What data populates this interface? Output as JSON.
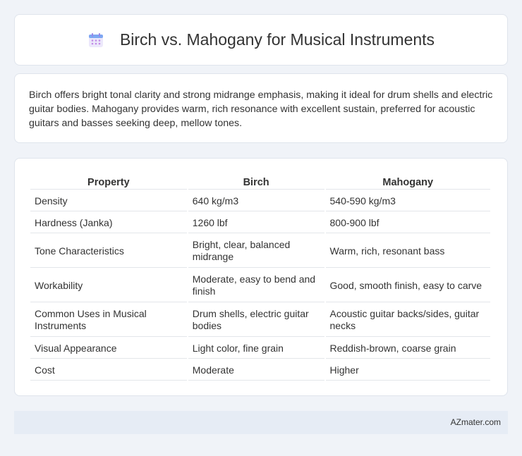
{
  "header": {
    "title": "Birch vs. Mahogany for Musical Instruments",
    "icon": "calendar-icon"
  },
  "intro": "Birch offers bright tonal clarity and strong midrange emphasis, making it ideal for drum shells and electric guitar bodies. Mahogany provides warm, rich resonance with excellent sustain, preferred for acoustic guitars and basses seeking deep, mellow tones.",
  "table": {
    "headers": [
      "Property",
      "Birch",
      "Mahogany"
    ],
    "rows": [
      [
        "Density",
        "640 kg/m3",
        "540-590 kg/m3"
      ],
      [
        "Hardness (Janka)",
        "1260 lbf",
        "800-900 lbf"
      ],
      [
        "Tone Characteristics",
        "Bright, clear, balanced midrange",
        "Warm, rich, resonant bass"
      ],
      [
        "Workability",
        "Moderate, easy to bend and finish",
        "Good, smooth finish, easy to carve"
      ],
      [
        "Common Uses in Musical Instruments",
        "Drum shells, electric guitar bodies",
        "Acoustic guitar backs/sides, guitar necks"
      ],
      [
        "Visual Appearance",
        "Light color, fine grain",
        "Reddish-brown, coarse grain"
      ],
      [
        "Cost",
        "Moderate",
        "Higher"
      ]
    ]
  },
  "footer": {
    "brand": "AZmater.com"
  }
}
